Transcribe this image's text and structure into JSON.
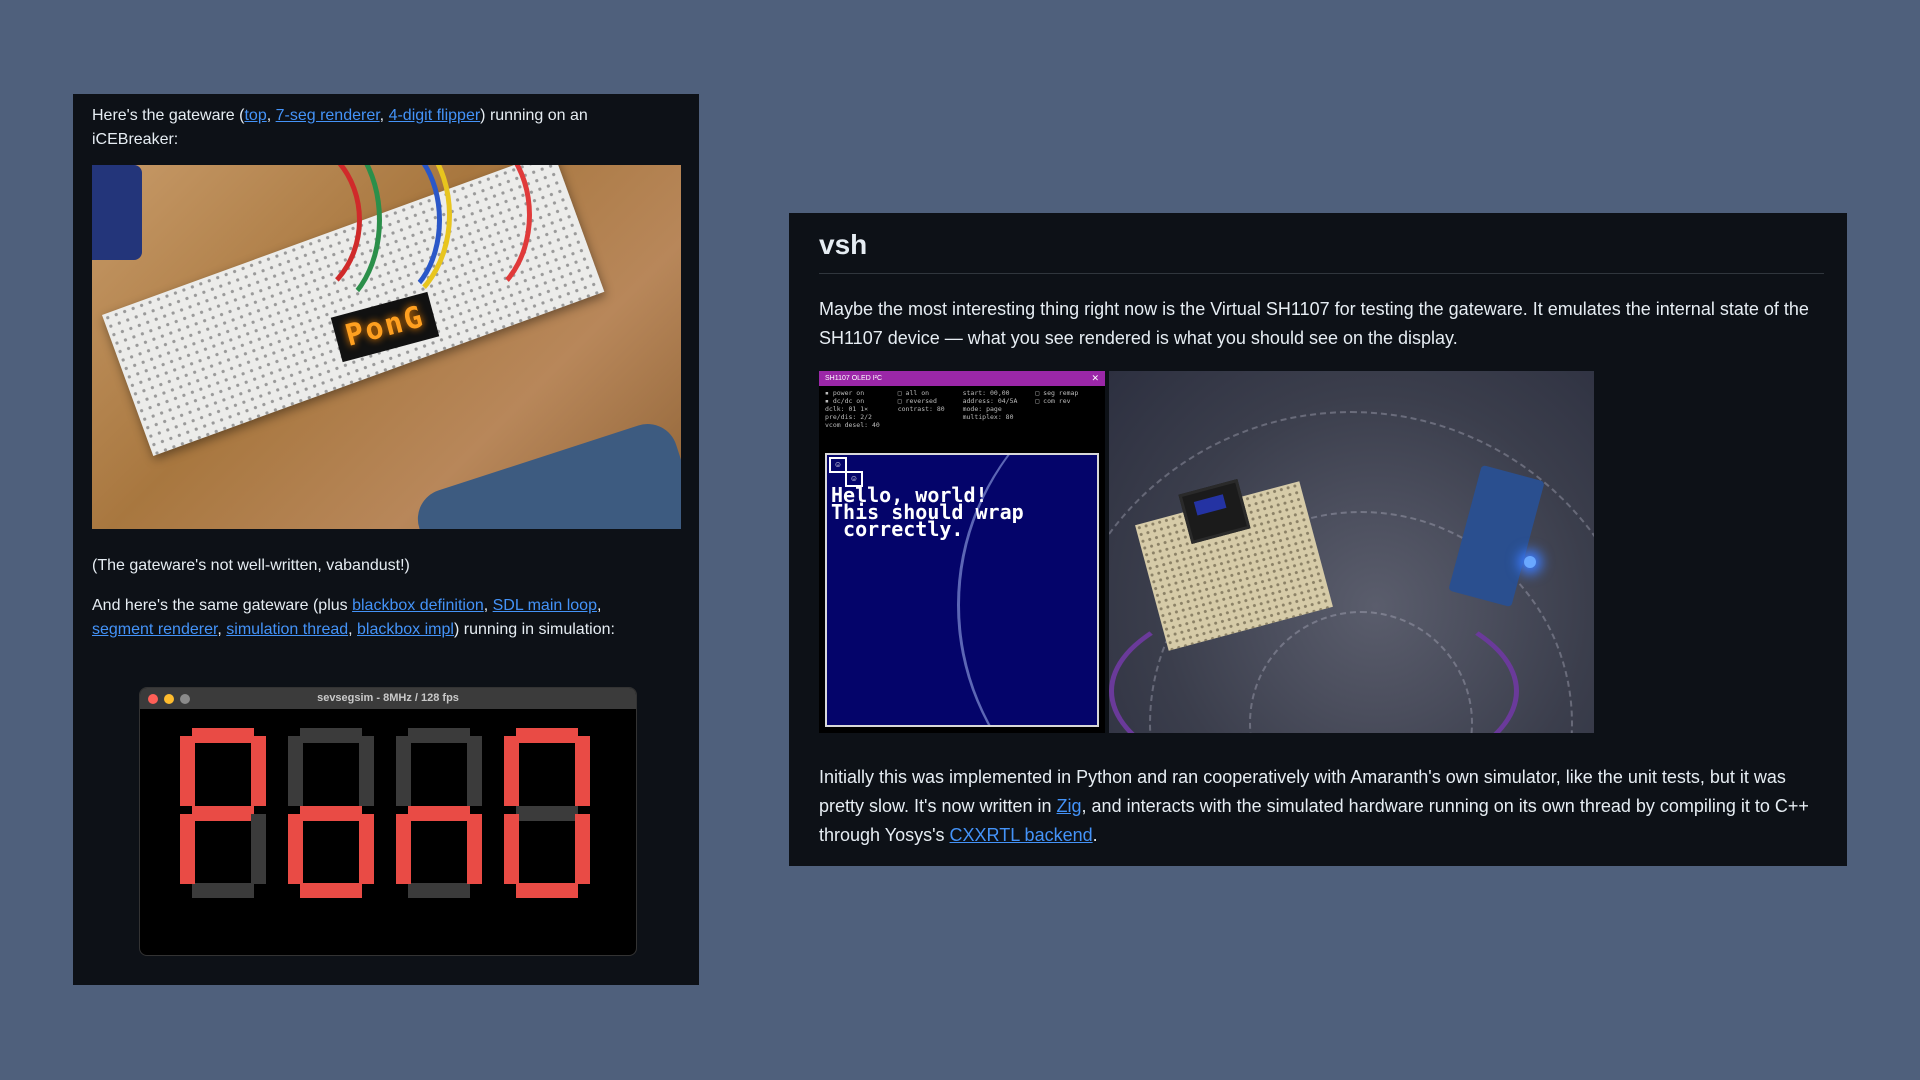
{
  "left_panel": {
    "intro": {
      "prefix": "Here's the gateware (",
      "link_top": "top",
      "sep1": ", ",
      "link_7seg": "7-seg renderer",
      "sep2": ", ",
      "link_flipper": "4-digit flipper",
      "suffix": ") running on an iCEBreaker:"
    },
    "breadboard_display_text": "PonG",
    "caption": "(The gateware's not well-written, vabandust!)",
    "sim_intro": {
      "prefix": "And here's the same gateware (plus ",
      "link_blackbox_def": "blackbox definition",
      "sep1": ", ",
      "link_sdl": "SDL main loop",
      "sep2": ", ",
      "link_segment": "segment renderer",
      "sep3": ", ",
      "link_sim_thread": "simulation thread",
      "sep4": ", ",
      "link_blackbox_impl": "blackbox impl",
      "suffix": ") running in simulation:"
    },
    "sim_window": {
      "title": "sevsegsim - 8MHz / 128 fps",
      "traffic_colors": [
        "#ff5f57",
        "#febc2e",
        "#8a8a8a"
      ],
      "segment_on_color": "#e94b45",
      "segment_off_color": "#3b3b3b",
      "digits": [
        {
          "a": true,
          "b": true,
          "c": false,
          "d": false,
          "e": true,
          "f": true,
          "g": true
        },
        {
          "a": false,
          "b": false,
          "c": true,
          "d": true,
          "e": true,
          "f": false,
          "g": true
        },
        {
          "a": false,
          "b": false,
          "c": true,
          "d": false,
          "e": true,
          "f": false,
          "g": true
        },
        {
          "a": true,
          "b": true,
          "c": true,
          "d": true,
          "e": true,
          "f": true,
          "g": false
        }
      ]
    }
  },
  "right_panel": {
    "heading": "vsh",
    "paragraph1": "Maybe the most interesting thing right now is the Virtual SH1107 for testing the gateware. It emulates the internal state of the SH1107 device — what you see rendered is what you should see on the display.",
    "oled_window": {
      "title": "SH1107 OLED I²C",
      "close_glyph": "✕",
      "status_col1": [
        "▪ power on",
        "▪ dc/dc on",
        "dclk: 01 1×",
        "pre/dis: 2/2",
        "vcom desel: 40"
      ],
      "status_col2": [
        "□ all on",
        "□ reversed",
        "contrast: 80"
      ],
      "status_col3": [
        "start: 00,00",
        "address: 04/5A",
        "mode: page",
        "multiplex: 80"
      ],
      "status_col4": [
        "□ seg remap",
        "□ com rev"
      ],
      "screen_text": "Hello, world!\nThis should wrap\n correctly."
    },
    "paragraph2": {
      "prefix": "Initially this was implemented in Python and ran cooperatively with Amaranth's own simulator, like the unit tests, but it was pretty slow. It's now written in ",
      "link_zig": "Zig",
      "middle": ", and interacts with the simulated hardware running on its own thread by compiling it to C++ through Yosys's ",
      "link_cxxrtl": "CXXRTL backend",
      "suffix": "."
    }
  },
  "colors": {
    "background": "#4f607c",
    "panel": "#0d1117",
    "text": "#e6edf3",
    "link": "#4493f8"
  }
}
